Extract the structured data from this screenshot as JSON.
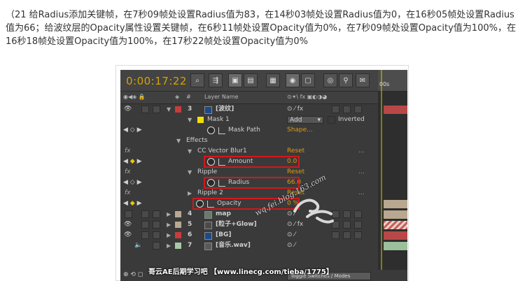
{
  "intro_text": "（21 给Radius添加关键帧，在7秒09帧处设置Radius值为83，在14秒03帧处设置Radius值为0，在16秒05帧处设置Radius值为66；给波纹层的Opacity属性设置关键帧，在6秒11帧处设置Opacity值为0%，在7秒09帧处设置Opacity值为100%，在16秒18帧处设置Opacity值为100%，在17秒22帧处设置Opacity值为0%",
  "timeline": {
    "timecode": "0:00:17:22",
    "ruler_label": "00s",
    "column_header": "Layer Name"
  },
  "layers": [
    {
      "num": "3",
      "name": "[波纹]",
      "color": "#c83c3c",
      "icon_color": "#1a4a8a"
    },
    {
      "num": "4",
      "name": "map",
      "color": "#b8a890",
      "icon_color": "#6a7a6a"
    },
    {
      "num": "5",
      "name": "[粒子+Glow]",
      "color": "#b8a890",
      "icon_color": "#4a4a4a"
    },
    {
      "num": "6",
      "name": "[BG]",
      "color": "#c83c3c",
      "icon_color": "#1a4a8a"
    },
    {
      "num": "7",
      "name": "[音乐.wav]",
      "color": "#a8c8a8",
      "icon_color": "#5a5a5a"
    }
  ],
  "mask": {
    "name": "Mask 1",
    "mode": "Add",
    "inverted_label": "Inverted",
    "path_label": "Mask Path",
    "path_value": "Shape..."
  },
  "effects": {
    "group_label": "Effects",
    "items": [
      {
        "name": "CC Vector Blur1",
        "reset": "Reset",
        "extra": "...",
        "prop": "Amount",
        "value": "0.0"
      },
      {
        "name": "Ripple",
        "reset": "Reset",
        "extra": "...",
        "prop": "Radius",
        "value": "66.0"
      },
      {
        "name": "Ripple 2",
        "reset": "Reset",
        "extra": "...",
        "prop": "Opacity",
        "value": "0 %"
      }
    ]
  },
  "footer": {
    "toggle_label": "Toggle Switches / Modes"
  },
  "watermark": {
    "bottom": "哥云AE后期学习吧  【www.linecg.com/tieba/1775】",
    "diagonal": "wq.fei.blog.163.com"
  },
  "colors": {
    "accent_orange": "#e09a14",
    "timecode_yellow": "#d7a200",
    "highlight_red": "#d4171b"
  }
}
